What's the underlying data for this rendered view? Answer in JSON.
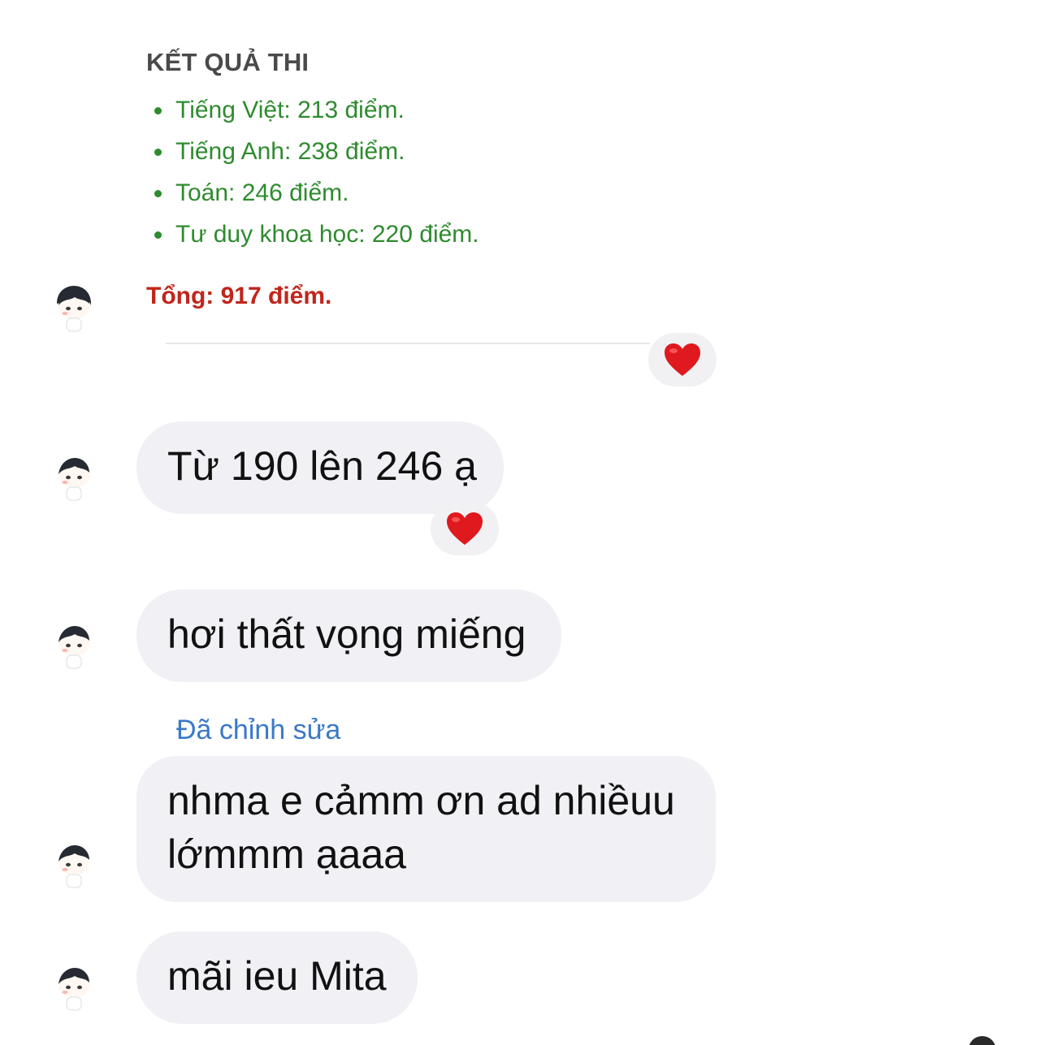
{
  "results": {
    "title": "KẾT QUẢ THI",
    "subjects": [
      "Tiếng Việt: 213 điểm.",
      "Tiếng Anh: 238 điểm.",
      "Toán: 246 điểm.",
      "Tư duy khoa học: 220 điểm."
    ],
    "total": "Tổng: 917 điểm.",
    "reaction": "heart"
  },
  "messages": [
    {
      "text": "Từ 190 lên 246 ạ",
      "reaction": "heart"
    },
    {
      "text": "hơi thất vọng miếng"
    },
    {
      "label": "Đã chỉnh sửa",
      "text": "nhma e cảmm ơn ad nhiềuu lớmmm ạaaa"
    },
    {
      "text": "mãi ieu Mita"
    }
  ],
  "colors": {
    "subject_green": "#2e8b2e",
    "total_red": "#c0261c",
    "edited_blue": "#3a79c9",
    "bubble_bg": "#f0f0f5",
    "heart": "#e0191f"
  }
}
